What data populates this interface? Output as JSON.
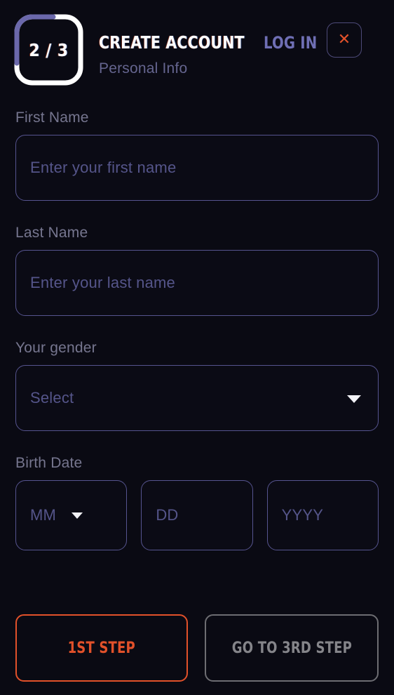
{
  "header": {
    "step_badge": "2 / 3",
    "step_current": 2,
    "step_total": 3,
    "title": "CREATE ACCOUNT",
    "login_link": "LOG IN",
    "subtitle": "Personal Info",
    "close_icon": "close-icon",
    "close_glyph": "✕"
  },
  "form": {
    "fields": [
      {
        "label": "First Name",
        "placeholder": "Enter your first name",
        "value": "",
        "type": "text"
      },
      {
        "label": "Last Name",
        "placeholder": "Enter your last name",
        "value": "",
        "type": "text"
      },
      {
        "label": "Your gender",
        "placeholder": "Select",
        "value": "Select",
        "type": "select"
      }
    ],
    "birth_date": {
      "label": "Birth Date",
      "month": {
        "placeholder": "MM",
        "value": "MM",
        "type": "select"
      },
      "day": {
        "placeholder": "DD",
        "value": "",
        "type": "text"
      },
      "year": {
        "placeholder": "YYYY",
        "value": "",
        "type": "text"
      }
    }
  },
  "buttons": {
    "prev": "1ST STEP",
    "next": "GO TO 3RD STEP"
  },
  "colors": {
    "background": "#0a0a13",
    "accent_orange": "#e2512a",
    "accent_purple": "#6f6fb4",
    "ring_progress": "#6b68ab",
    "ring_track": "#ffffff",
    "border_input": "#56548f",
    "label_text": "#76768f",
    "placeholder_text": "#55558a",
    "button_next_border": "#6d6d72",
    "button_next_text": "#85858a"
  }
}
